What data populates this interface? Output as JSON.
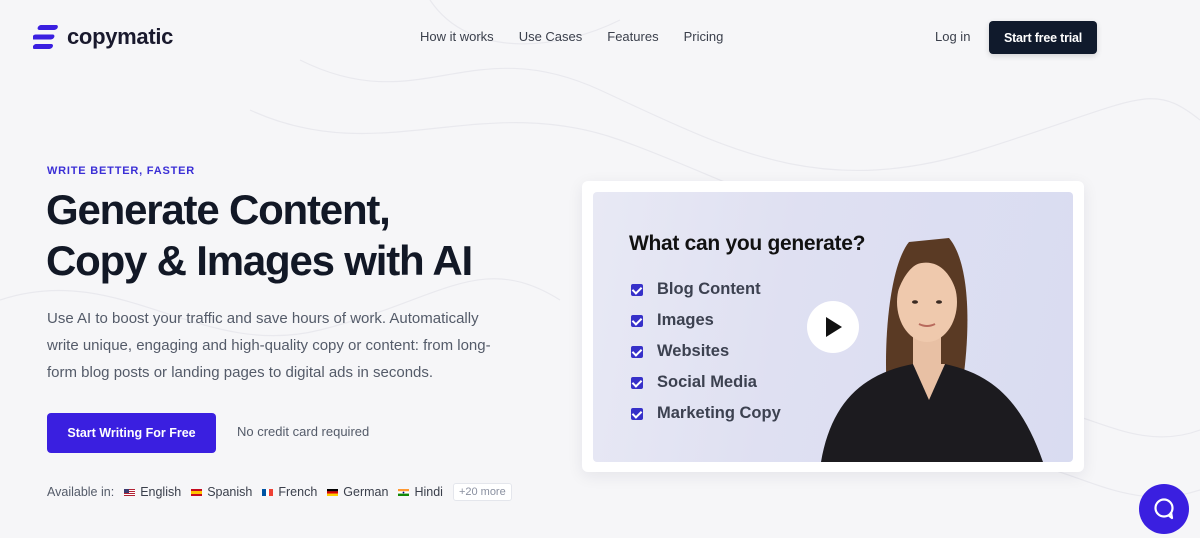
{
  "brand": {
    "name": "copymatic",
    "accent": "#3a1fe0",
    "dark": "#101a2c"
  },
  "nav": {
    "items": [
      "How it works",
      "Use Cases",
      "Features",
      "Pricing"
    ],
    "login": "Log in",
    "cta": "Start free trial"
  },
  "hero": {
    "eyebrow": "WRITE BETTER, FASTER",
    "headline_line1": "Generate Content,",
    "headline_line2": "Copy & Images with AI",
    "subtext": "Use AI to boost your traffic and save hours of work. Automatically write unique, engaging and high-quality copy or content: from long-form blog posts or landing pages to digital ads in seconds.",
    "cta": "Start Writing For Free",
    "note": "No credit card required"
  },
  "languages": {
    "label": "Available in:",
    "items": [
      {
        "name": "English",
        "flag": "us-flag-icon"
      },
      {
        "name": "Spanish",
        "flag": "spain-flag-icon"
      },
      {
        "name": "French",
        "flag": "france-flag-icon"
      },
      {
        "name": "German",
        "flag": "germany-flag-icon"
      },
      {
        "name": "Hindi",
        "flag": "india-flag-icon"
      }
    ],
    "more": "+20 more"
  },
  "video": {
    "title": "What can you generate?",
    "items": [
      "Blog Content",
      "Images",
      "Websites",
      "Social Media",
      "Marketing Copy"
    ],
    "play_icon": "play-icon"
  },
  "chat": {
    "icon": "chat-icon"
  }
}
